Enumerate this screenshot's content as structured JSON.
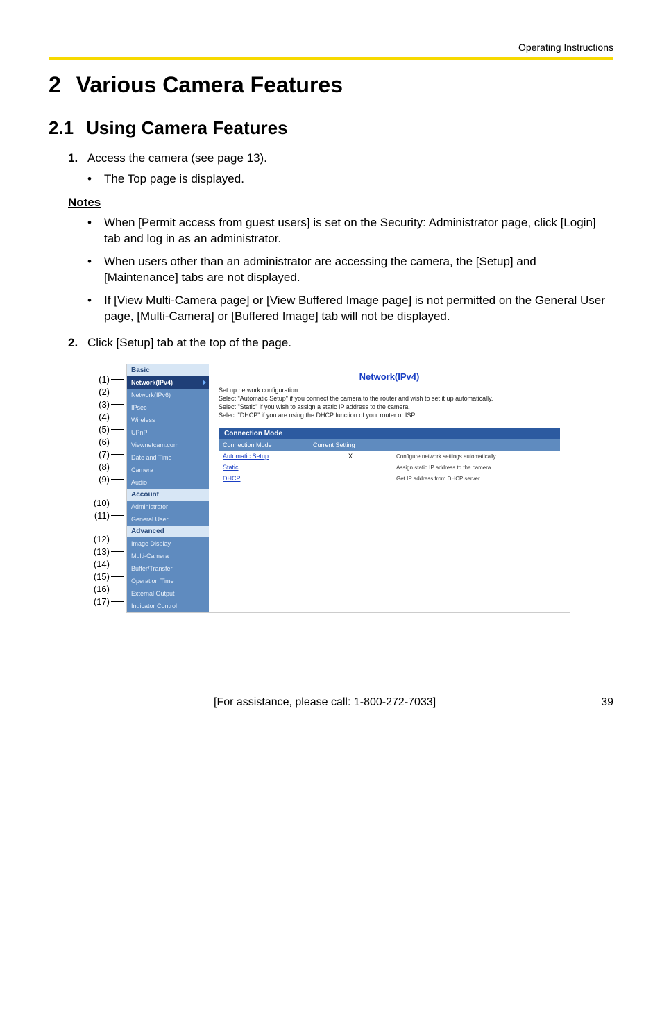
{
  "running_header": "Operating Instructions",
  "chapter": {
    "num": "2",
    "title": "Various Camera Features"
  },
  "section": {
    "num": "2.1",
    "title": "Using Camera Features"
  },
  "steps": {
    "s1": {
      "num": "1.",
      "text": "Access the camera (see page 13)."
    },
    "s1_sub": "The Top page is displayed.",
    "s2": {
      "num": "2.",
      "text": "Click [Setup] tab at the top of the page."
    }
  },
  "notes_head": "Notes",
  "notes": [
    "When [Permit access from guest users] is set on the Security: Administrator page, click [Login] tab and log in as an administrator.",
    "When users other than an administrator are accessing the camera, the [Setup] and [Maintenance] tabs are not displayed.",
    "If [View Multi-Camera page] or [View Buffered Image page] is not permitted on the General User page, [Multi-Camera] or [Buffered Image] tab will not be displayed."
  ],
  "callouts": {
    "g1": [
      "(1)",
      "(2)",
      "(3)",
      "(4)",
      "(5)",
      "(6)",
      "(7)",
      "(8)",
      "(9)"
    ],
    "g2": [
      "(10)",
      "(11)"
    ],
    "g3": [
      "(12)",
      "(13)",
      "(14)",
      "(15)",
      "(16)",
      "(17)"
    ]
  },
  "sidebar": {
    "basic_head": "Basic",
    "basic_items": [
      "Network(IPv4)",
      "Network(IPv6)",
      "IPsec",
      "Wireless",
      "UPnP",
      "Viewnetcam.com",
      "Date and Time",
      "Camera",
      "Audio"
    ],
    "account_head": "Account",
    "account_items": [
      "Administrator",
      "General User"
    ],
    "advanced_head": "Advanced",
    "advanced_items": [
      "Image Display",
      "Multi-Camera",
      "Buffer/Transfer",
      "Operation Time",
      "External Output",
      "Indicator Control"
    ]
  },
  "content": {
    "title": "Network(IPv4)",
    "desc_l1": "Set up network configuration.",
    "desc_l2": "Select \"Automatic Setup\" if you connect the camera to the router and wish to set it up automatically.",
    "desc_l3": "Select \"Static\" if you wish to assign a static IP address to the camera.",
    "desc_l4": "Select \"DHCP\" if you are using the DHCP function of your router or ISP.",
    "panel_head": "Connection Mode",
    "th_mode": "Connection Mode",
    "th_setting": "Current Setting",
    "rows": [
      {
        "mode": "Automatic Setup",
        "setting": "X",
        "desc": "Configure network settings automatically."
      },
      {
        "mode": "Static",
        "setting": "",
        "desc": "Assign static IP address to the camera."
      },
      {
        "mode": "DHCP",
        "setting": "",
        "desc": "Get IP address from DHCP server."
      }
    ]
  },
  "footer": {
    "assist": "[For assistance, please call: 1-800-272-7033]",
    "page": "39"
  }
}
